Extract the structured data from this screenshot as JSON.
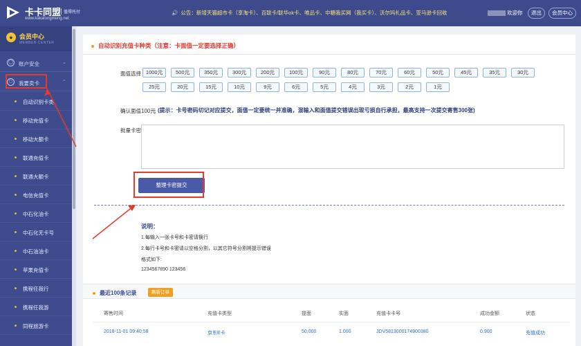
{
  "header": {
    "brand_title": "卡卡同盟",
    "brand_tag": "值得托付",
    "brand_url": "www.kakatongmeng.net",
    "notice": "公告：新增天猫超市卡（享淘卡）、百联卡/联华ok卡、唯品卡、中糖我买网（我买卡）、沃尔玛礼品卡、亚马逊卡回收",
    "welcome_text": "欢迎你",
    "logout_label": "退出",
    "member_center_label": "会员中心"
  },
  "sidebar": {
    "member_title": "会员中心",
    "member_subtitle": "MEMBER CENTER",
    "groups": [
      {
        "label": "账户安全",
        "icon": "shield-icon"
      },
      {
        "label": "我要卖卡",
        "icon": "card-icon"
      }
    ],
    "items": [
      "自动识别卡类",
      "移动充值卡",
      "移动大额卡",
      "联通充值卡",
      "联通大额卡",
      "电信充值卡",
      "中石化油卡",
      "中石化无卡号",
      "中石油油卡",
      "苹果充值卡",
      "携程任我行",
      "携程任我游",
      "同程旅游卡"
    ]
  },
  "form": {
    "section_title": "自动识别充值卡种类（注意：卡面值一定要选择正确）",
    "denomination_label": "面值选择",
    "denominations_row1": [
      "1000元",
      "500元",
      "350元",
      "300元",
      "200元",
      "100元",
      "90元",
      "80元",
      "70元",
      "60元",
      "50元",
      "45元",
      "35元",
      "30元"
    ],
    "denominations_row2": [
      "25元",
      "20元",
      "15元",
      "10元",
      "9元",
      "6元",
      "5元",
      "4元",
      "3元",
      "2元",
      "1元"
    ],
    "confirm_label": "确认面值",
    "confirm_value": "100元",
    "confirm_tip": "(提示：卡号密码切记对应提交，面值一定要统一并准确，混输入和面值提交错误出现亏损自行承担，最高支持一次提交寄售300张)",
    "batch_label": "批量卡密",
    "submit_label": "整理卡密提交"
  },
  "instructions": {
    "title": "说明：",
    "lines": [
      "1.每输入一张卡号和卡密请换行",
      "2.每行卡号和卡密请以空格分割，以其它符号分割将提示错误",
      "格式如下:",
      "1234567890 123456"
    ]
  },
  "records": {
    "title": "最近100条记录",
    "refresh_label": "刷新订单",
    "columns": [
      "寄售时间",
      "充值卡类型",
      "提面",
      "实面",
      "充值卡卡号",
      "成功金额",
      "状态"
    ],
    "rows": [
      [
        "2018-11-01 09:40:58",
        "京东E卡",
        "50.000",
        "1.000",
        "JDV5813000174900380",
        "0.900",
        "充值成功"
      ]
    ]
  },
  "colors": {
    "header_bg": "#3d4a8c",
    "notice_text": "#ffe27a",
    "accent_red": "#e53a2e",
    "button_blue": "#4a5aa8",
    "refresh_orange": "#f0a020"
  }
}
